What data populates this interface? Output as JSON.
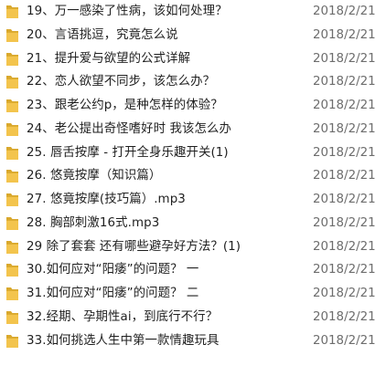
{
  "colors": {
    "folder_body": "#f3c44d",
    "folder_edge": "#d9a82d",
    "name_text": "#1f1f1f",
    "date_text": "#6d6d6d"
  },
  "icon": "folder-icon",
  "files": [
    {
      "name": "19、万一感染了性病，该如何处理？",
      "date": "2018/2/21"
    },
    {
      "name": "20、言语挑逗，究竟怎么说",
      "date": "2018/2/21"
    },
    {
      "name": "21、提升爱与欲望的公式详解",
      "date": "2018/2/21"
    },
    {
      "name": "22、恋人欲望不同步，该怎么办？",
      "date": "2018/2/21"
    },
    {
      "name": "23、跟老公约p，是种怎样的体验？",
      "date": "2018/2/21"
    },
    {
      "name": "24、老公提出奇怪嗜好时 我该怎么办",
      "date": "2018/2/21"
    },
    {
      "name": "25. 唇舌按摩 - 打开全身乐趣开关(1)",
      "date": "2018/2/21"
    },
    {
      "name": "26. 悠竟按摩（知识篇）",
      "date": "2018/2/21"
    },
    {
      "name": "27. 悠竟按摩(技巧篇）.mp3",
      "date": "2018/2/21"
    },
    {
      "name": "28. 胸部刺激16式.mp3",
      "date": "2018/2/21"
    },
    {
      "name": "29 除了套套 还有哪些避孕好方法？(1)",
      "date": "2018/2/21"
    },
    {
      "name": "30.如何应对“阳痿”的问题？ 一",
      "date": "2018/2/21"
    },
    {
      "name": "31.如何应对“阳痿”的问题？ 二",
      "date": "2018/2/21"
    },
    {
      "name": "32.经期、孕期性ai，到底行不行？",
      "date": "2018/2/21"
    },
    {
      "name": "33.如何挑选人生中第一款情趣玩具",
      "date": "2018/2/21"
    },
    {
      "name": "",
      "date": ""
    }
  ]
}
